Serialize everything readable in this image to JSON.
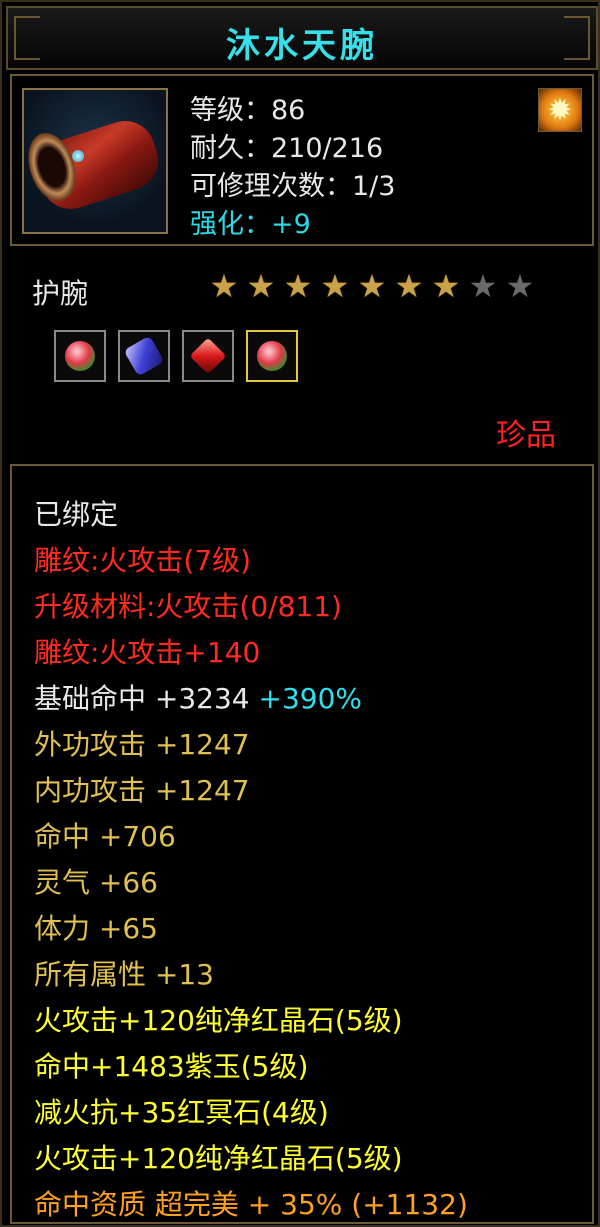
{
  "item": {
    "name": "沐水天腕",
    "type": "护腕",
    "rarity": "珍品",
    "icon": "red-bracer-icon",
    "badge_icon": "flame-swirl-icon"
  },
  "stats": {
    "level": "等级：86",
    "durability": "耐久：210/216",
    "repair": "可修理次数：1/3",
    "enhance": "强化：+9"
  },
  "stars": {
    "total": 9,
    "lit": 7
  },
  "gems": [
    {
      "icon": "red-green-gem-icon"
    },
    {
      "icon": "blue-jade-gem-icon"
    },
    {
      "icon": "red-crystal-icon"
    },
    {
      "icon": "red-green-gem-icon",
      "selected": true
    }
  ],
  "details": {
    "bound": "已绑定",
    "engrave": "雕纹:火攻击(7级)",
    "upgrade_material": "升级材料:火攻击(0/811)",
    "engrave_bonus": "雕纹:火攻击+140",
    "base_hit": "基础命中 +3234",
    "base_hit_pct": "+390%",
    "outer_attack": "外功攻击 +1247",
    "inner_attack": "内功攻击 +1247",
    "hit": "命中 +706",
    "spirit": "灵气 +66",
    "stamina": "体力 +65",
    "all_attr": "所有属性 +13",
    "gem1": "火攻击+120纯净红晶石(5级)",
    "gem2": "命中+1483紫玉(5级)",
    "gem3": "减火抗+35红冥石(4级)",
    "gem4": "火攻击+120纯净红晶石(5级)",
    "quality": "命中资质 超完美 + 35% (+1132)"
  },
  "colors": {
    "title": "#37e0e8",
    "red": "#ff2a20",
    "gold": "#e0c050",
    "yellow": "#ffff30",
    "orange": "#ffa020",
    "cyan": "#30e0f0"
  }
}
